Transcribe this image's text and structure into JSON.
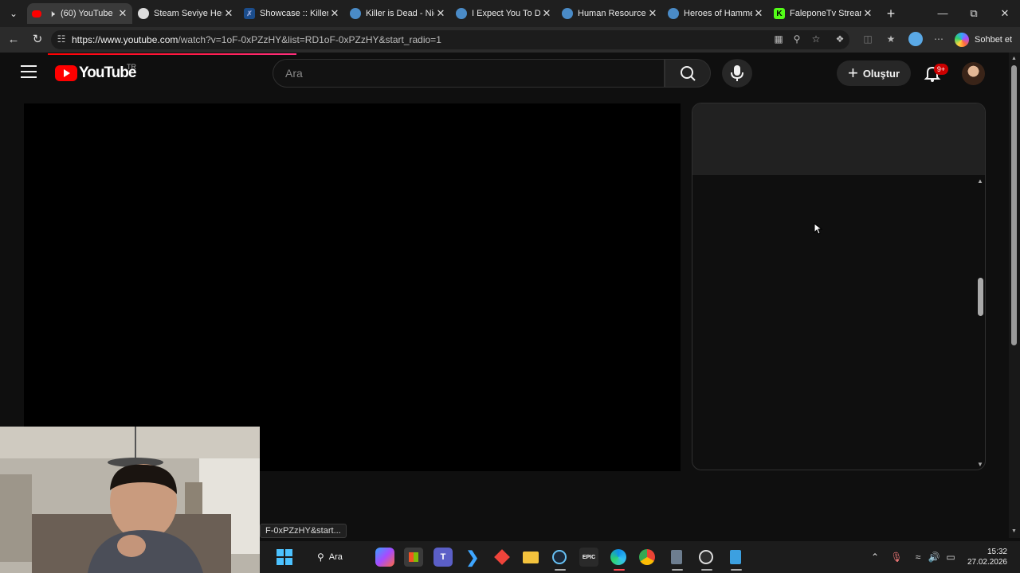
{
  "browser": {
    "tabs": [
      {
        "title": "(60) YouTube",
        "active": true,
        "icon": "youtube-icon"
      },
      {
        "title": "Steam Seviye Hesap",
        "active": false,
        "icon": "steam-seviye-icon"
      },
      {
        "title": "Showcase :: Killer is",
        "active": false,
        "icon": "steam-icon"
      },
      {
        "title": "Killer is Dead - Nigh",
        "active": false,
        "icon": "steam-icon"
      },
      {
        "title": "I Expect You To Die",
        "active": false,
        "icon": "steam-icon"
      },
      {
        "title": "Human Resource M",
        "active": false,
        "icon": "steam-icon"
      },
      {
        "title": "Heroes of Hammer",
        "active": false,
        "icon": "steam-icon"
      },
      {
        "title": "FaleponeTv Stream",
        "active": false,
        "icon": "kick-icon"
      }
    ],
    "url_host": "https://www.youtube.com",
    "url_path": "/watch?v=1oF-0xPZzHY&list=RD1oF-0xPZzHY&start_radio=1",
    "copilot_label": "Sohbet et"
  },
  "youtube": {
    "logo_text": "YouTube",
    "region": "TR",
    "search_placeholder": "Ara",
    "create_label": "Oluştur",
    "notification_count": "9+"
  },
  "status_bar_url": "F-0xPZzHY&start...",
  "taskbar": {
    "search_label": "Ara",
    "time": "15:32",
    "date": "27.02.2026"
  },
  "colors": {
    "accent": "#ff0000",
    "background": "#0f0f0f"
  }
}
